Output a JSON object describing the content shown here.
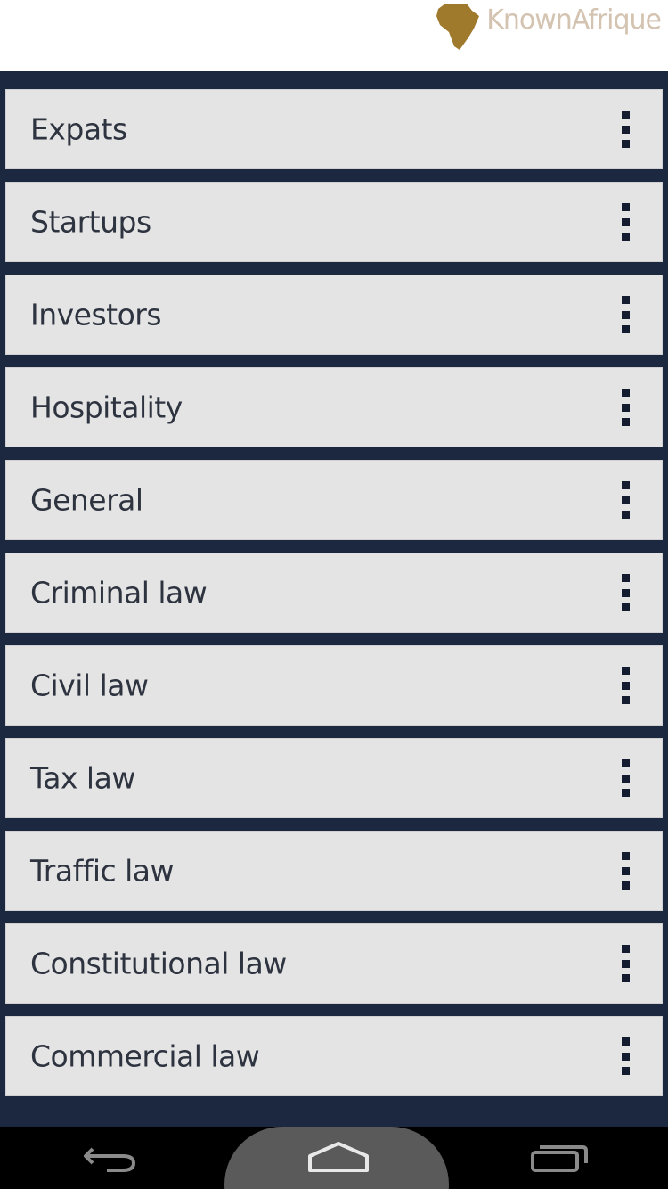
{
  "header": {
    "logo_text": "KnownAfrique",
    "brand_color": "#a07a2c"
  },
  "list": {
    "items": [
      {
        "label": "Expats"
      },
      {
        "label": "Startups"
      },
      {
        "label": "Investors"
      },
      {
        "label": "Hospitality"
      },
      {
        "label": "General"
      },
      {
        "label": "Criminal law"
      },
      {
        "label": "Civil law"
      },
      {
        "label": "Tax law"
      },
      {
        "label": "Traffic law"
      },
      {
        "label": "Constitutional law"
      },
      {
        "label": "Commercial law"
      }
    ],
    "item_icon": "more-vertical-icon"
  },
  "navbar": {
    "buttons": [
      "back-icon",
      "home-icon",
      "recent-apps-icon"
    ]
  },
  "colors": {
    "background": "#1c2740",
    "item_background": "#e4e4e4",
    "text": "#2e3340",
    "navbar": "#000000"
  }
}
